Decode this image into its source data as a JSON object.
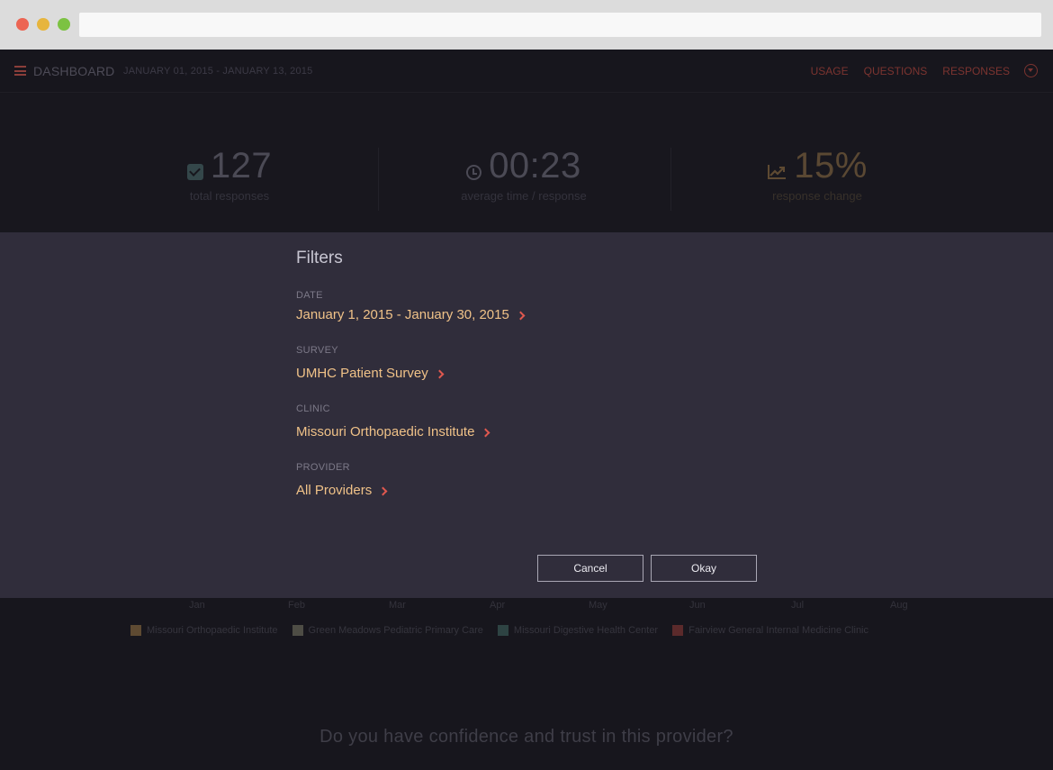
{
  "header": {
    "title": "DASHBOARD",
    "date_range": "JANUARY 01, 2015 - JANUARY 13, 2015",
    "nav": [
      "USAGE",
      "QUESTIONS",
      "RESPONSES"
    ]
  },
  "stats": [
    {
      "value": "127",
      "label": "total responses",
      "icon": "check-icon"
    },
    {
      "value": "00:23",
      "label": "average time / response",
      "icon": "clock-icon"
    },
    {
      "value": "15%",
      "label": "response change",
      "icon": "trend-icon"
    }
  ],
  "filters": {
    "title": "Filters",
    "groups": [
      {
        "label": "DATE",
        "value": "January 1, 2015 - January 30, 2015"
      },
      {
        "label": "SURVEY",
        "value": "UMHC Patient Survey"
      },
      {
        "label": "CLINIC",
        "value": "Missouri Orthopaedic Institute"
      },
      {
        "label": "PROVIDER",
        "value": "All Providers"
      }
    ],
    "cancel_label": "Cancel",
    "okay_label": "Okay"
  },
  "chart": {
    "months": [
      "Jan",
      "Feb",
      "Mar",
      "Apr",
      "May",
      "Jun",
      "Jul",
      "Aug"
    ],
    "legend": [
      {
        "label": "Missouri Orthopaedic Institute",
        "color": "#5e4a32"
      },
      {
        "label": "Green Meadows Pediatric Primary Care",
        "color": "#4e4d45"
      },
      {
        "label": "Missouri Digestive Health Center",
        "color": "#2e4343"
      },
      {
        "label": "Fairview General Internal Medicine Clinic",
        "color": "#5b2a2b"
      }
    ]
  },
  "question": "Do you have confidence and trust in this provider?",
  "colors": {
    "accent": "#e0584f",
    "value": "#f0c288",
    "panel": "#302d3b",
    "background": "#17161d"
  }
}
